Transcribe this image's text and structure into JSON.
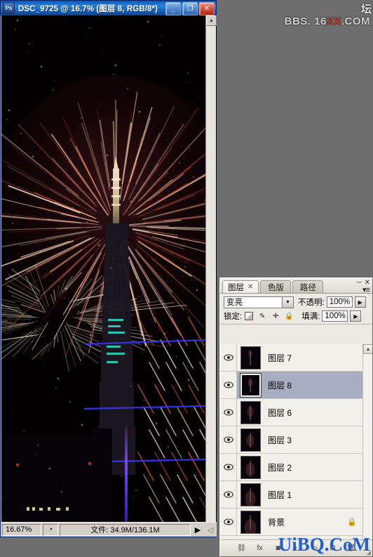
{
  "window": {
    "title": "DSC_9725 @ 16.7% (图层 8, RGB/8*)",
    "app_icon": "photoshop-icon",
    "buttons": [
      {
        "name": "minimize",
        "glyph": "_"
      },
      {
        "name": "maximize",
        "glyph": "❐"
      },
      {
        "name": "close",
        "glyph": "✕"
      }
    ]
  },
  "statusbar": {
    "zoom": "16.67%",
    "thumb_icon": "preview-icon",
    "file_info": "文件: 34.9M/136.1M",
    "arrow": "▶",
    "grip": "◁"
  },
  "panel": {
    "tabs": [
      {
        "label": "图层",
        "active": true,
        "close": "✕"
      },
      {
        "label": "色版",
        "active": false,
        "close": ""
      },
      {
        "label": "路径",
        "active": false,
        "close": ""
      }
    ],
    "minimize": "─",
    "close": "✕",
    "menu_icon": "panel-menu-icon",
    "blend_mode": "变亮",
    "opacity_label": "不透明:",
    "opacity_value": "100%",
    "lock_label": "锁定:",
    "lock_icons": [
      "lock-transparency-icon",
      "lock-image-icon",
      "lock-position-icon",
      "lock-all-icon"
    ],
    "fill_label": "填满:",
    "fill_value": "100%",
    "scroll_up": "▲",
    "layers": [
      {
        "name": "图层 7",
        "visible": true,
        "selected": false,
        "locked": false
      },
      {
        "name": "图层 8",
        "visible": true,
        "selected": true,
        "locked": false
      },
      {
        "name": "图层 6",
        "visible": true,
        "selected": false,
        "locked": false
      },
      {
        "name": "图层 3",
        "visible": true,
        "selected": false,
        "locked": false
      },
      {
        "name": "图层 2",
        "visible": true,
        "selected": false,
        "locked": false
      },
      {
        "name": "图层 1",
        "visible": true,
        "selected": false,
        "locked": false
      },
      {
        "name": "背景",
        "visible": true,
        "selected": false,
        "locked": true
      }
    ],
    "bottom_buttons": [
      {
        "name": "link-layers-button",
        "glyph": "⛓"
      },
      {
        "name": "layer-style-button",
        "glyph": "fx"
      },
      {
        "name": "layer-mask-button",
        "glyph": "◙"
      },
      {
        "name": "adjustment-layer-button",
        "glyph": "◐"
      },
      {
        "name": "new-group-button",
        "glyph": "▭"
      },
      {
        "name": "new-layer-button",
        "glyph": "⊡"
      },
      {
        "name": "delete-layer-button",
        "glyph": "🗑"
      }
    ],
    "grip": "◢"
  },
  "watermarks": {
    "top": "BBS. 16XX.COM",
    "top_prefix": "BBS. 16",
    "top_red": "XX",
    "top_suffix": ".COM",
    "side": "坛",
    "bottom": "UiBQ.CoM"
  },
  "colors": {
    "title_bar": "#1462c4",
    "selected_layer": "#a8acc0",
    "panel_bg": "#ebe9e2",
    "watermark_blue": "#1155cc"
  }
}
